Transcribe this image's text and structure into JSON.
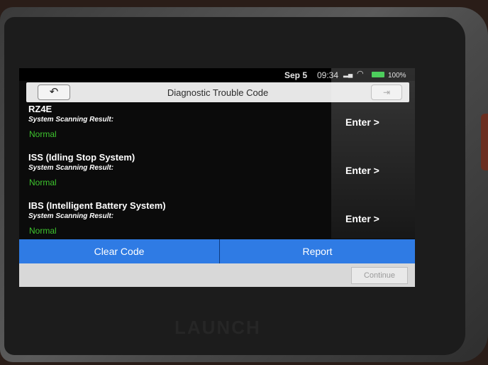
{
  "device": {
    "brand": "LAUNCH"
  },
  "status": {
    "date": "Sep 5",
    "time": "09:34",
    "signal_icon": "signal-icon",
    "wifi_icon": "wifi-icon",
    "battery": "100%"
  },
  "header": {
    "back_icon": "↶",
    "title": "Diagnostic Trouble Code",
    "exit_icon": "⇥"
  },
  "systems": [
    {
      "name": "RZ4E",
      "scan_label": "System Scanning Result:",
      "result": "Normal",
      "action": "Enter >"
    },
    {
      "name": "ISS (Idling Stop System)",
      "scan_label": "System Scanning Result:",
      "result": "Normal",
      "action": "Enter >"
    },
    {
      "name": "IBS (Intelligent Battery System)",
      "scan_label": "System Scanning Result:",
      "result": "Normal",
      "action": "Enter >"
    }
  ],
  "actions": {
    "clear_code": "Clear Code",
    "report": "Report"
  },
  "footer": {
    "continue": "Continue"
  },
  "colors": {
    "accent": "#2f7be4",
    "ok": "#3ec42e",
    "title_bar": "#e6e6e6"
  }
}
